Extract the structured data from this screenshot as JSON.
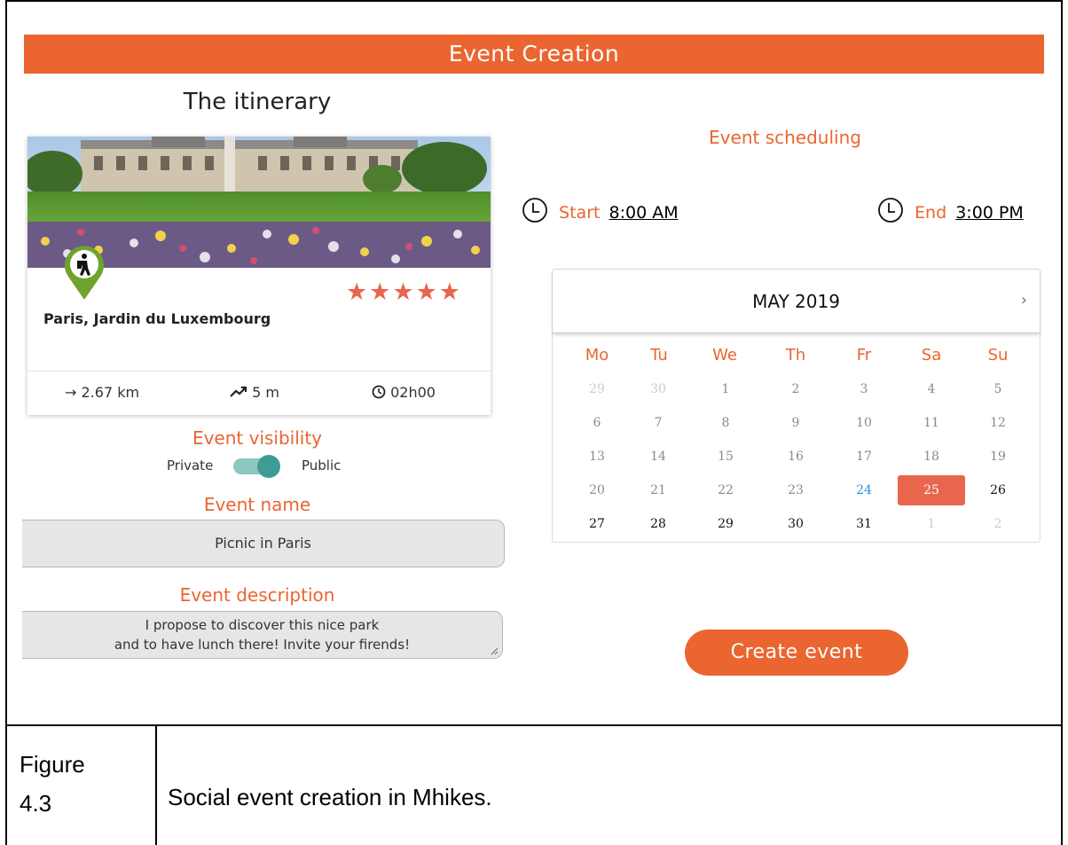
{
  "header": {
    "title": "Event Creation"
  },
  "itinerary": {
    "title": "The itinerary",
    "route_name": "Paris, Jardin du Luxembourg",
    "rating_stars": "★★★★★",
    "rating_value": 5,
    "distance": "→ 2.67 km",
    "elevation": "5 m",
    "duration": "02h00"
  },
  "visibility": {
    "title": "Event visibility",
    "left_label": "Private",
    "right_label": "Public",
    "selected": "Public"
  },
  "event_name": {
    "title": "Event name",
    "value": "Picnic in Paris"
  },
  "event_description": {
    "title": "Event description",
    "line1": "I propose to discover this nice park",
    "line2": "and to have lunch there! Invite your firends!"
  },
  "scheduling": {
    "title": "Event scheduling",
    "start_label": "Start",
    "start_value": "8:00 AM",
    "end_label": "End",
    "end_value": "3:00 PM"
  },
  "calendar": {
    "month": "MAY 2019",
    "next_icon": "›",
    "weekdays": [
      "Mo",
      "Tu",
      "We",
      "Th",
      "Fr",
      "Sa",
      "Su"
    ],
    "weeks": [
      [
        "29",
        "30",
        "1",
        "2",
        "3",
        "4",
        "5"
      ],
      [
        "6",
        "7",
        "8",
        "9",
        "10",
        "11",
        "12"
      ],
      [
        "13",
        "14",
        "15",
        "16",
        "17",
        "18",
        "19"
      ],
      [
        "20",
        "21",
        "22",
        "23",
        "24",
        "25",
        "26"
      ],
      [
        "27",
        "28",
        "29",
        "30",
        "31",
        "1",
        "2"
      ]
    ],
    "selected_day": "25",
    "today": "24"
  },
  "create_button": {
    "label": "Create event"
  },
  "caption": {
    "label_line1": "Figure",
    "label_line2": "4.3",
    "text": "Social event creation in Mhikes."
  },
  "colors": {
    "accent": "#EA6530",
    "star": "#E8664E",
    "toggle": "#3D9D92",
    "today": "#2f8fd8"
  },
  "icons": [
    "hiker-pin-icon",
    "star-icon",
    "arrow-right-icon",
    "trending-up-icon",
    "clock-icon",
    "chevron-right-icon"
  ]
}
